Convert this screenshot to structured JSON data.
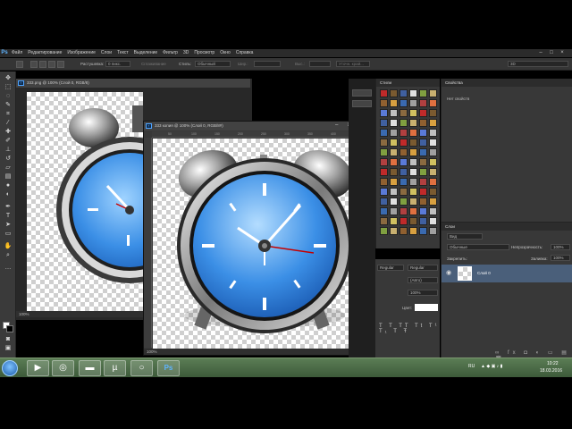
{
  "app": {
    "logo": "Ps"
  },
  "menu": [
    "Файл",
    "Редактирование",
    "Изображение",
    "Слои",
    "Текст",
    "Выделение",
    "Фильтр",
    "3D",
    "Просмотр",
    "Окно",
    "Справка"
  ],
  "options": {
    "feather_label": "Растушевка:",
    "feather_value": "0 пикс.",
    "antialias": "Сглаживание",
    "style_label": "Стиль:",
    "style_value": "Обычный",
    "width_label": "Шир.:",
    "height_label": "Выс.:",
    "refine_edge": "Уточн. край...",
    "workspace": "3D"
  },
  "doc1": {
    "title": "333.png @ 100% (Слой 0, RGB/8)",
    "zoom": "100%"
  },
  "doc2": {
    "title": "333 копия @ 100% (Слой 0, RGB/8#)",
    "zoom": "100%",
    "ruler_ticks": [
      "50",
      "100",
      "150",
      "200",
      "250",
      "300",
      "350",
      "400",
      "450"
    ]
  },
  "styles_panel": {
    "title": "Стили"
  },
  "props_panel": {
    "title": "Свойства",
    "empty_text": "Нет свойств"
  },
  "layers_panel": {
    "title": "Слои",
    "kind": "Вид",
    "blend_mode": "Обычные",
    "opacity_label": "Непрозрачность:",
    "opacity_value": "100%",
    "lock_label": "Закрепить:",
    "fill_label": "Заливка:",
    "fill_value": "100%",
    "layer_name": "Слой 0"
  },
  "char_panel": {
    "font_style": "Regular",
    "font_style2": "Regular",
    "leading": "(Авто)",
    "size": "100%",
    "color_label": "Цвет:"
  },
  "taskbar": {
    "lang": "RU",
    "time": "10:22",
    "date": "18.03.2016",
    "ps_label": "Ps"
  },
  "colors": {
    "accent": "#4a5f7a",
    "canvas_bg": "#282828",
    "clock_blue": "#3b8fe6"
  }
}
